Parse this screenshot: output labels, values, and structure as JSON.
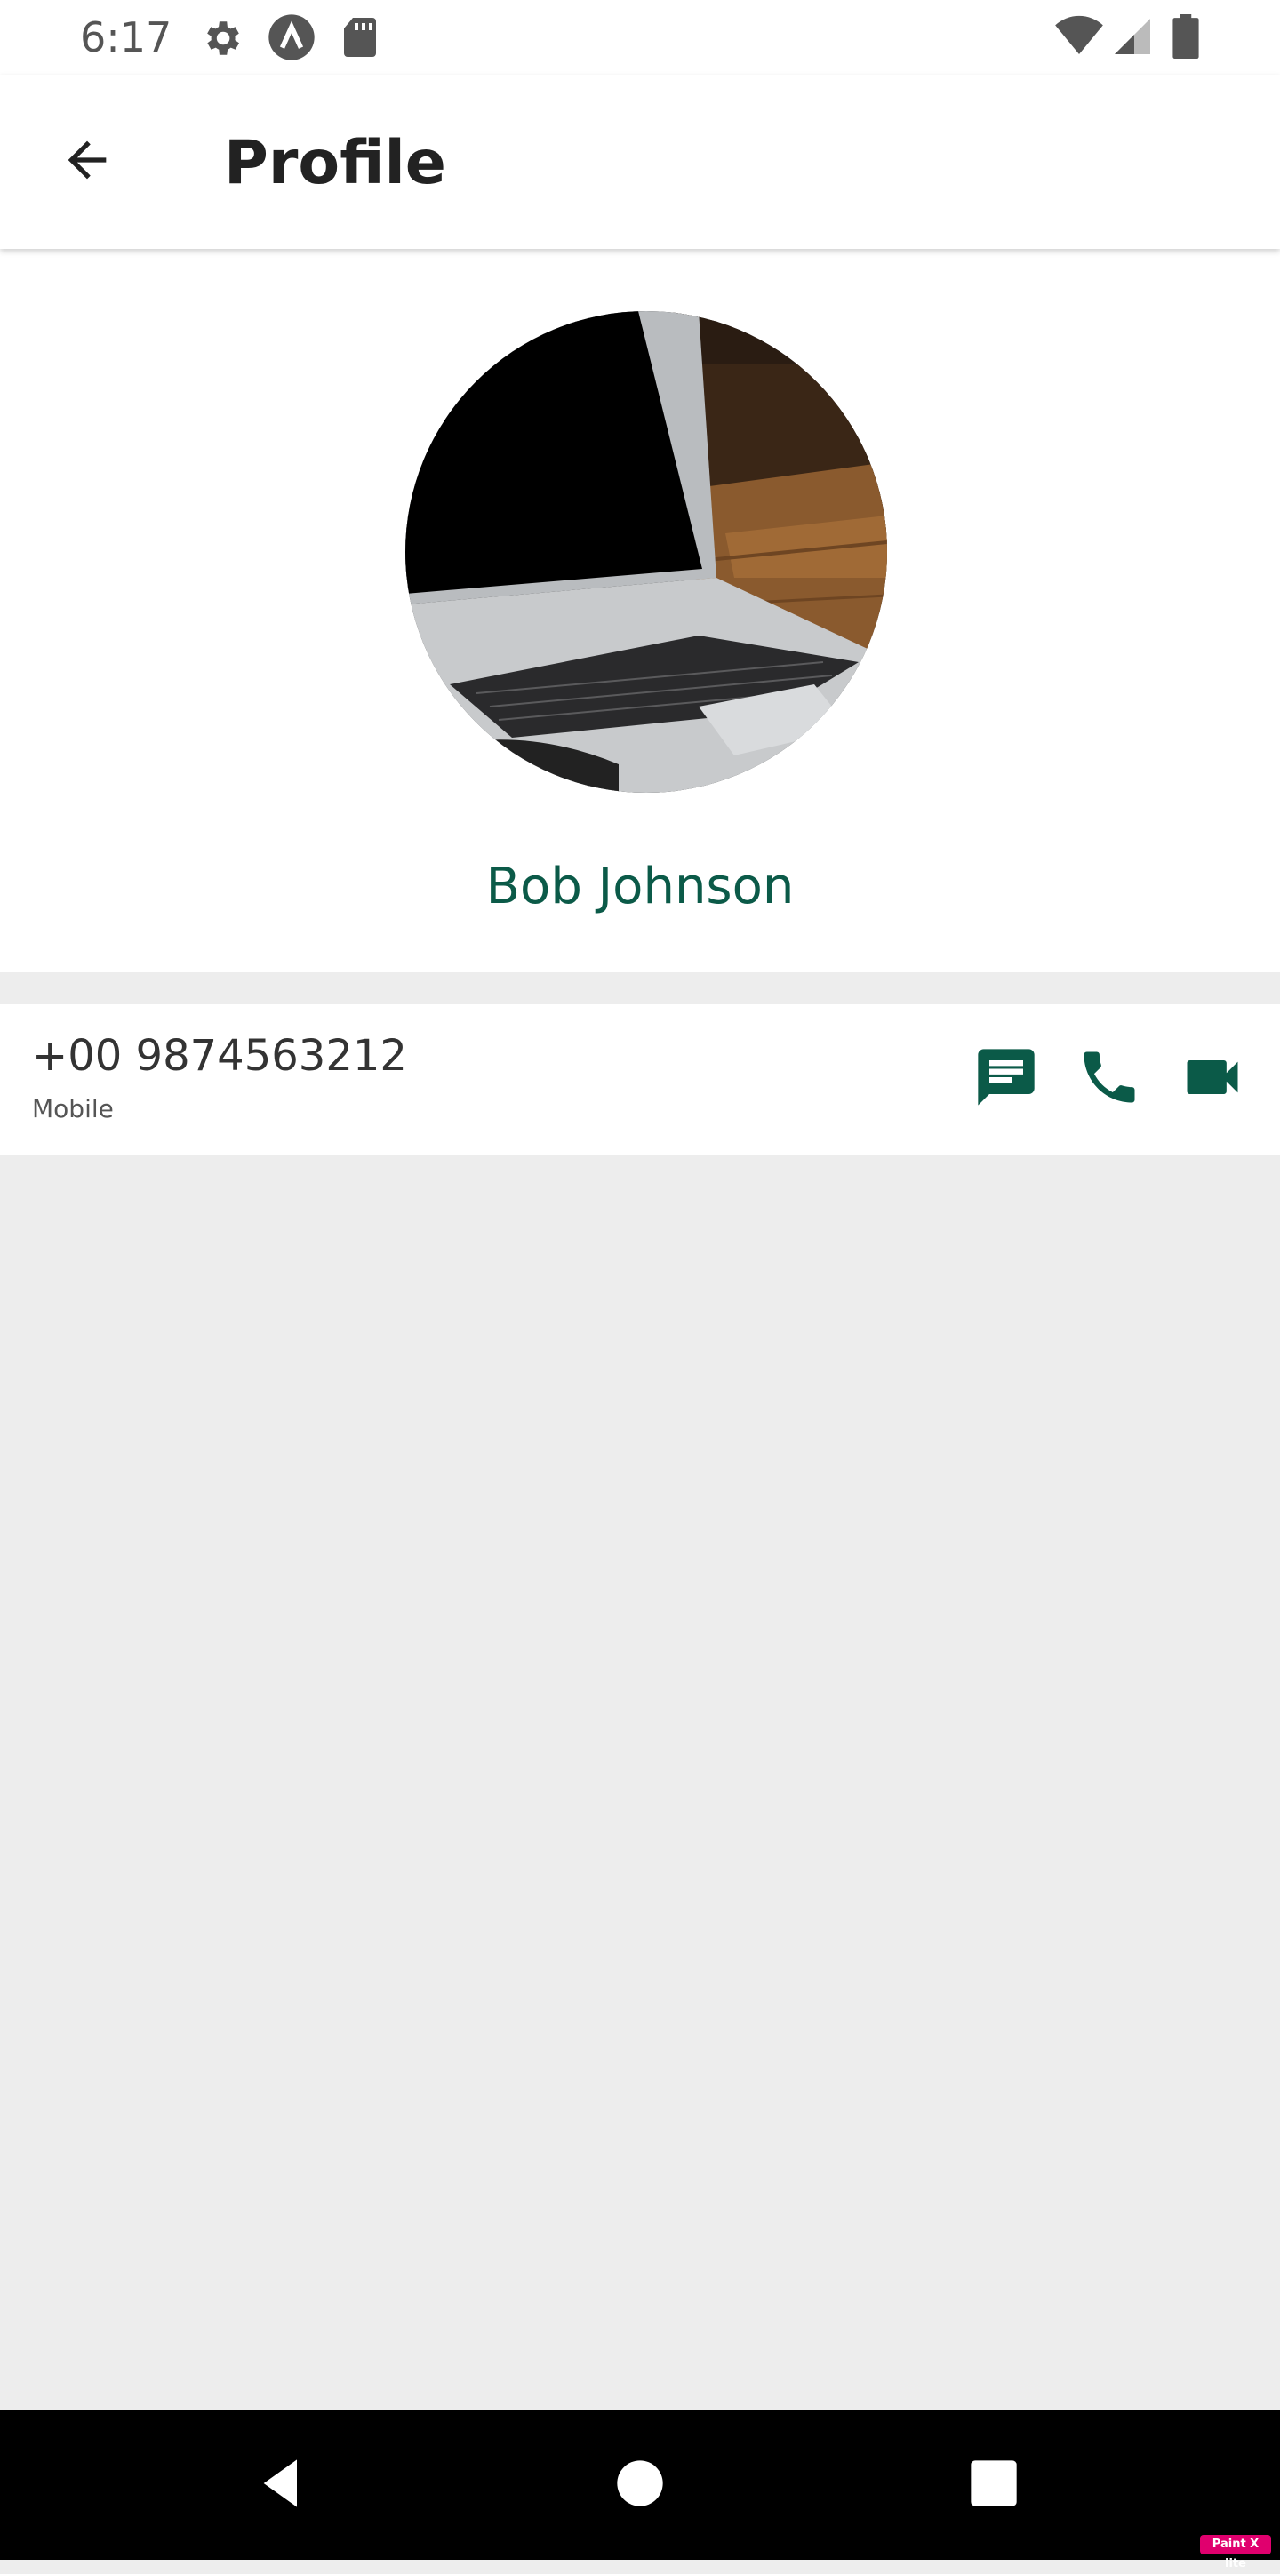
{
  "status_bar": {
    "time": "6:17",
    "left_icons": [
      "settings-icon",
      "a-circle-icon",
      "sd-card-icon"
    ],
    "right_icons": [
      "wifi-icon",
      "cell-signal-icon",
      "battery-icon"
    ]
  },
  "app_bar": {
    "back_icon": "arrow-left-icon",
    "title": "Profile"
  },
  "profile": {
    "avatar_description": "laptop-photo",
    "name": "Bob Johnson"
  },
  "contact": {
    "phone": "+00 9874563212",
    "type": "Mobile",
    "actions": [
      {
        "icon": "message-icon"
      },
      {
        "icon": "phone-icon"
      },
      {
        "icon": "video-call-icon"
      }
    ]
  },
  "nav_bar": {
    "buttons": [
      "back-triangle-icon",
      "home-circle-icon",
      "recents-square-icon"
    ]
  },
  "colors": {
    "accent": "#0b5a48",
    "background": "#ededed",
    "surface": "#ffffff",
    "nav_bar": "#000000"
  },
  "watermark": "Paint X lite"
}
